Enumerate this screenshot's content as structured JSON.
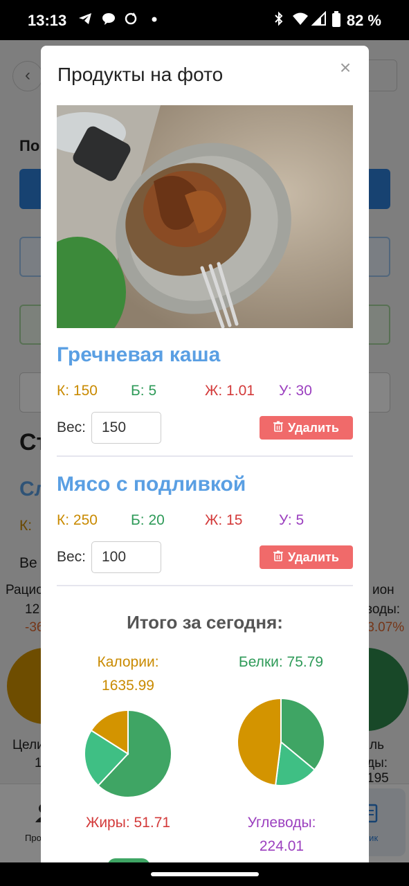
{
  "status_bar": {
    "time": "13:13",
    "battery": "82 %"
  },
  "background": {
    "heading_partial": "По",
    "section_heading": "Ст",
    "product_partial": "Сл",
    "k_partial": "К:",
    "weight_partial": "Ве",
    "left_label_1": "Рацио",
    "left_label_2": "12",
    "left_delta": "-36",
    "right_label_1": "ион",
    "right_label_2": "воды:",
    "right_delta": "-3.07%",
    "left_target_1": "Цели",
    "left_target_2": "1",
    "right_target_1": "ль",
    "right_target_2": "ды: 195",
    "nav_left": "Про",
    "nav_right": "ник"
  },
  "modal": {
    "title": "Продукты на фото",
    "close_icon": "close-icon",
    "products": [
      {
        "name": "Гречневая каша",
        "k": "К: 150",
        "b": "Б: 5",
        "zh": "Ж: 1.01",
        "u": "У: 30",
        "weight_label": "Вес:",
        "weight_value": "150",
        "delete_label": "Удалить"
      },
      {
        "name": "Мясо с подливкой",
        "k": "К: 250",
        "b": "Б: 20",
        "zh": "Ж: 15",
        "u": "У: 5",
        "weight_label": "Вес:",
        "weight_value": "100",
        "delete_label": "Удалить"
      }
    ],
    "summary": {
      "title": "Итого за сегодня:",
      "calories_label": "Калории:",
      "calories_value": "1635.99",
      "protein": "Белки: 75.79",
      "fat": "Жиры: 51.71",
      "carbs_label": "Углеводы:",
      "carbs_value": "224.01"
    }
  },
  "colors": {
    "product_title": "#5a9fe3",
    "calories": "#c98a00",
    "protein": "#2e9a58",
    "fat": "#d33a3a",
    "carbs": "#9b3fbf",
    "delete_button": "#f06a6a",
    "pie_green": "#3fa564",
    "pie_light_green": "#3fbf84",
    "pie_orange": "#d39400"
  },
  "chart_data": [
    {
      "type": "pie",
      "title": "Калории: 1635.99",
      "series": [
        {
          "values": [
            62,
            22,
            16
          ]
        }
      ]
    },
    {
      "type": "pie",
      "title": "Белки: 75.79",
      "series": [
        {
          "values": [
            36,
            16,
            48
          ]
        }
      ]
    }
  ]
}
